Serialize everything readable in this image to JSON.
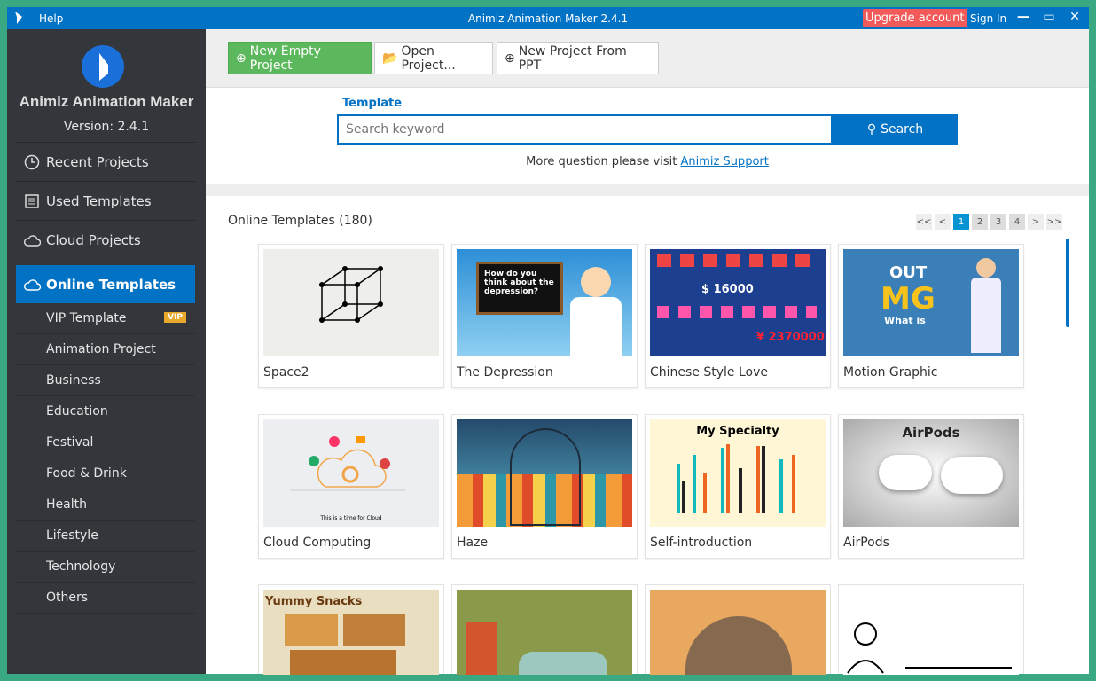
{
  "titlebar": {
    "menu_help": "Help",
    "title": "Animiz Animation Maker 2.4.1",
    "upgrade": "Upgrade account",
    "sign_in": "Sign In"
  },
  "sidebar": {
    "app_name": "Animiz Animation Maker",
    "version": "Version: 2.4.1",
    "nav": [
      {
        "label": "Recent Projects",
        "icon": "clock-icon"
      },
      {
        "label": "Used Templates",
        "icon": "list-icon"
      },
      {
        "label": "Cloud Projects",
        "icon": "cloud-icon"
      },
      {
        "label": "Online Templates",
        "icon": "cloud-icon",
        "active": true
      }
    ],
    "sub": [
      "VIP Template",
      "Animation Project",
      "Business",
      "Education",
      "Festival",
      "Food & Drink",
      "Health",
      "Lifestyle",
      "Technology",
      "Others"
    ],
    "vip_badge": "VIP"
  },
  "toolbar": {
    "new_empty": "New Empty Project",
    "open": "Open Project...",
    "from_ppt": "New Project From PPT"
  },
  "search": {
    "label": "Template",
    "placeholder": "Search keyword",
    "button": "Search",
    "more_text": "More question please visit ",
    "support_link": "Animiz Support"
  },
  "content": {
    "title": "Online Templates (180)",
    "pager": [
      "<<",
      "<",
      "1",
      "2",
      "3",
      "4",
      ">",
      ">>"
    ],
    "current_page": 1,
    "cards": [
      {
        "name": "Space2"
      },
      {
        "name": "The Depression"
      },
      {
        "name": "Chinese Style Love"
      },
      {
        "name": "Motion Graphic"
      },
      {
        "name": "Cloud Computing"
      },
      {
        "name": "Haze"
      },
      {
        "name": "Self-introduction"
      },
      {
        "name": "AirPods"
      },
      {
        "name": ""
      },
      {
        "name": ""
      },
      {
        "name": ""
      },
      {
        "name": ""
      }
    ],
    "thumb_text": {
      "depression": "How do you think about the depression?",
      "money1": "$ 16000",
      "money2": "¥ 2370000",
      "mg_out": "OUT",
      "mg": "MG",
      "mg_what": "What is",
      "specialty": "My Specialty",
      "airpods": "AirPods",
      "snacks": "Yummy Snacks",
      "cloud": "This is a time for Cloud"
    }
  },
  "colors": {
    "accent": "#0272c5",
    "sidebar": "#33363b",
    "green": "#5cb85c",
    "upgrade": "#f25a5a"
  }
}
